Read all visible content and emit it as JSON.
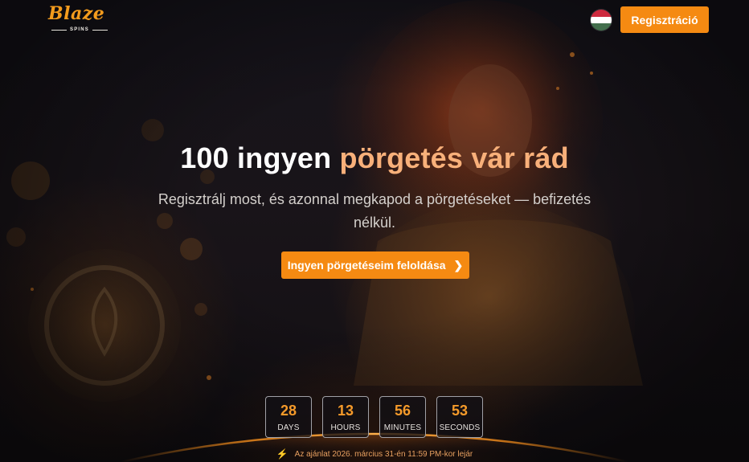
{
  "header": {
    "logo_word": "Blaze",
    "logo_sub": "SPINS",
    "flag_icon": "hungary-flag-icon",
    "flag_colors": [
      "#cd2a3e",
      "#ffffff",
      "#436f4d"
    ],
    "register_label": "Regisztráció"
  },
  "hero": {
    "headline_main": "100 ingyen ",
    "headline_accent": "pörgetés vár rád",
    "subtitle": "Regisztrálj most, és azonnal megkapod a pörgetéseket — befizetés nélkül.",
    "cta_label": "Ingyen pörgetéseim feloldása",
    "cta_icon": "chevron-right-icon"
  },
  "countdown": {
    "items": [
      {
        "value": "28",
        "label": "DAYS"
      },
      {
        "value": "13",
        "label": "HOURS"
      },
      {
        "value": "56",
        "label": "MINUTES"
      },
      {
        "value": "53",
        "label": "SECONDS"
      }
    ]
  },
  "offer": {
    "icon": "lightning-bolt-icon",
    "text": "Az ajánlat 2026. március 31-én 11:59 PM-kor lejár"
  },
  "colors": {
    "accent": "#f58a12",
    "accent_text": "#f59a2a",
    "headline_highlight": "#f8b07a",
    "background": "#15131a"
  }
}
